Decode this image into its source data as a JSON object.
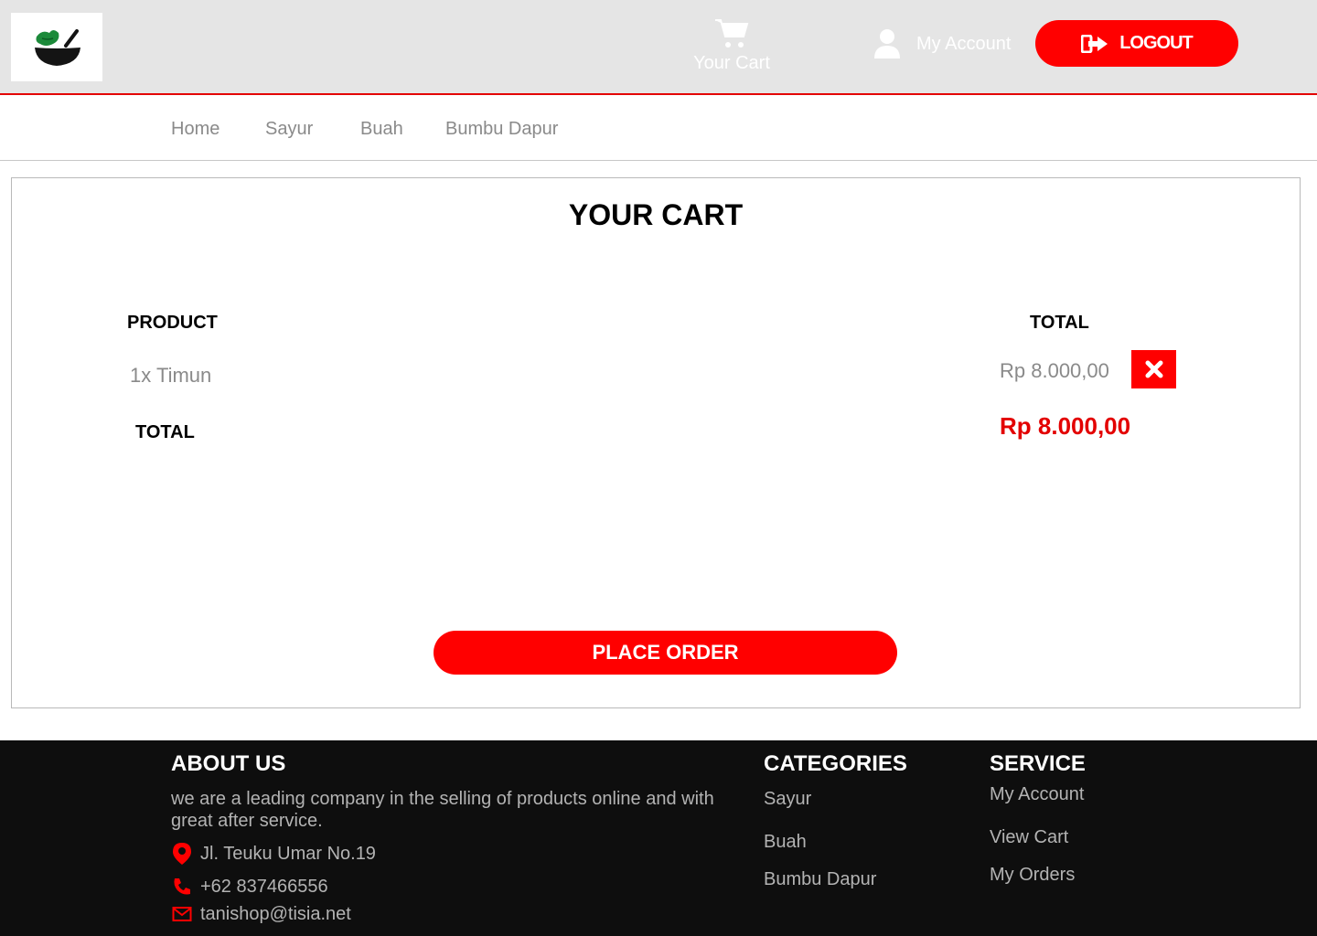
{
  "header": {
    "cart_label": "Your Cart",
    "account_label": "My Account",
    "logout_label": "LOGOUT"
  },
  "nav": {
    "items": [
      "Home",
      "Sayur",
      "Buah",
      "Bumbu Dapur"
    ]
  },
  "cart": {
    "title": "YOUR CART",
    "product_header": "PRODUCT",
    "total_header": "TOTAL",
    "items": [
      {
        "product": "1x Timun",
        "price": "Rp 8.000,00"
      }
    ],
    "total_label": "TOTAL",
    "grand_total": "Rp 8.000,00",
    "place_order_label": "PLACE ORDER"
  },
  "footer": {
    "about_heading": "ABOUT US",
    "about_text": "we are a leading company in the selling of products online and with great after service.",
    "address": "Jl. Teuku Umar No.19",
    "phone": "+62 837466556",
    "email": "tanishop@tisia.net",
    "categories_heading": "CATEGORIES",
    "categories": [
      "Sayur",
      "Buah",
      "Bumbu Dapur"
    ],
    "service_heading": "SERVICE",
    "service_links": [
      "My Account",
      "View Cart",
      "My Orders"
    ]
  },
  "colors": {
    "accent": "#ff0000",
    "header_bg": "#e5e5e5",
    "footer_bg": "#0e0e0e"
  },
  "icons": [
    "logo-bowl-icon",
    "cart-icon",
    "user-icon",
    "logout-icon",
    "close-icon",
    "location-pin-icon",
    "phone-icon",
    "mail-icon"
  ]
}
